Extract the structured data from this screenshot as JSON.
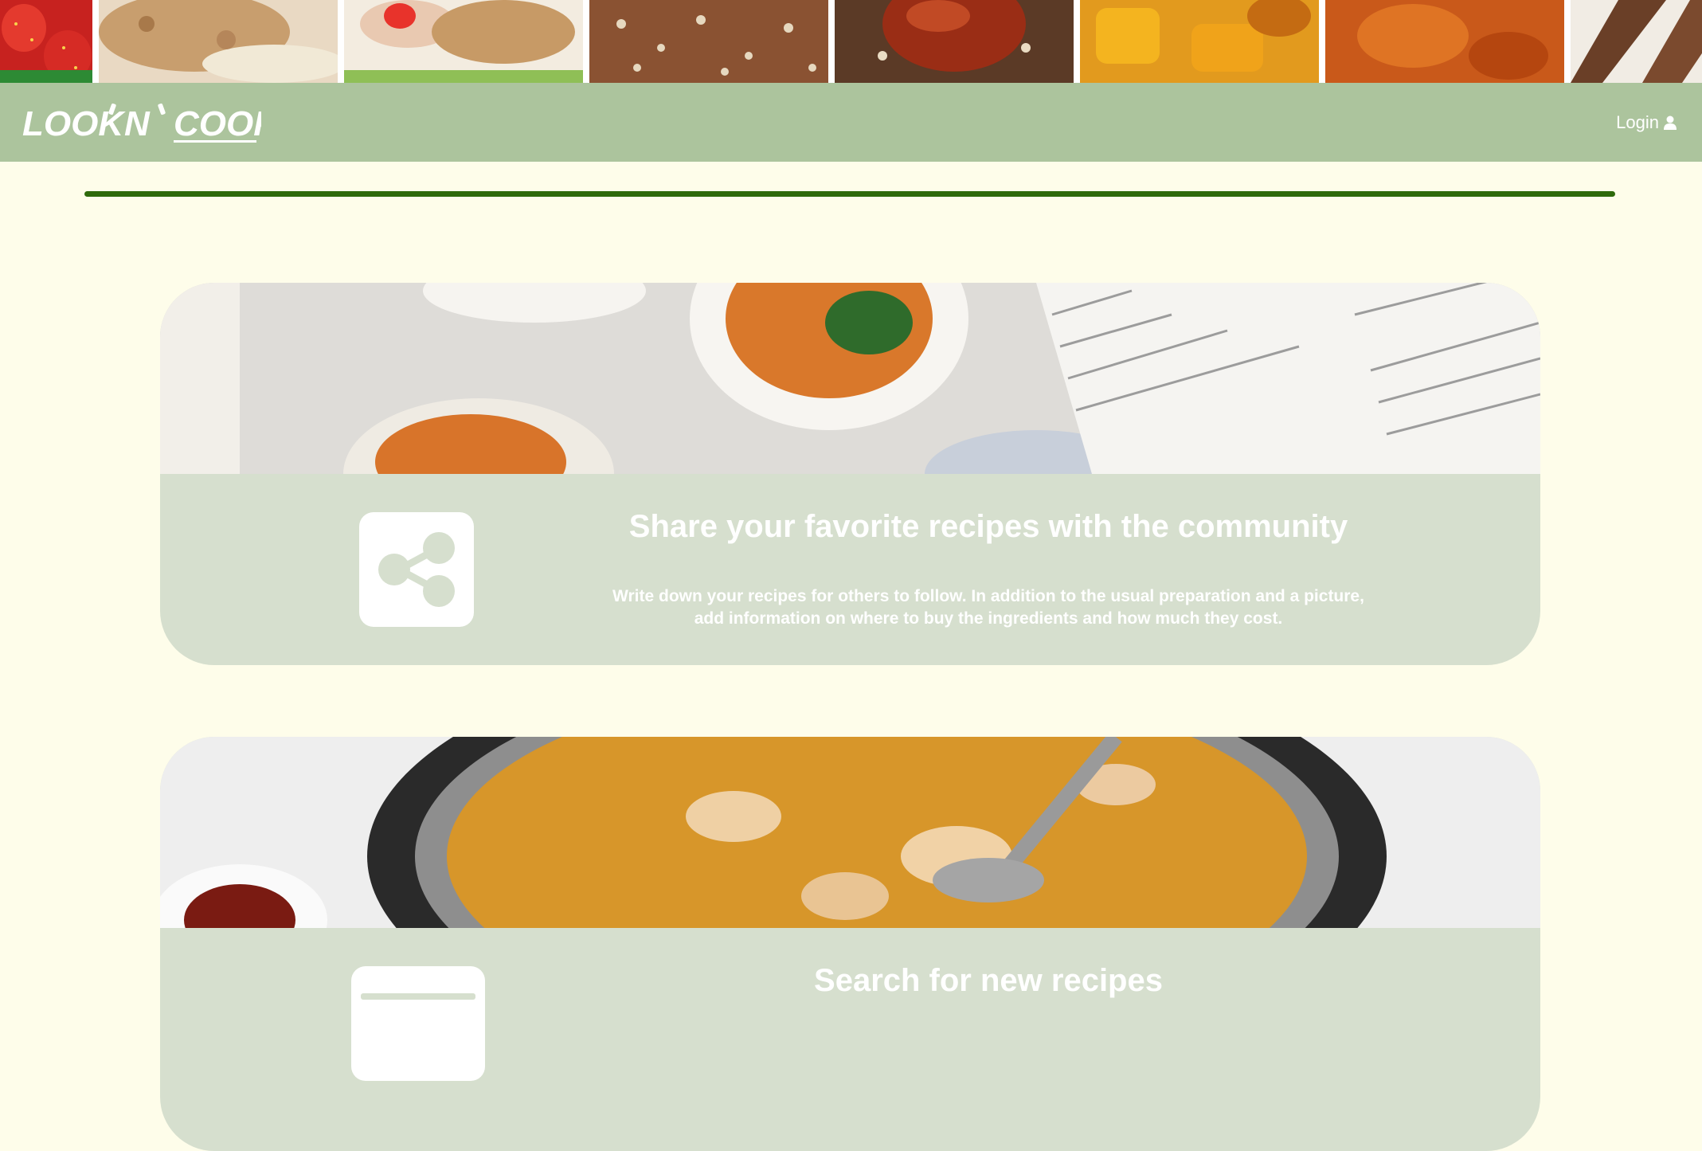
{
  "header": {
    "logo": {
      "look": "LOOK",
      "n": "N",
      "cook": "COOK"
    },
    "login_label": "Login",
    "login_icon": "user-icon"
  },
  "cards": [
    {
      "icon": "share-icon",
      "title": "Share your favorite recipes with the community",
      "description": "Write down your recipes for others to follow. In addition to the usual preparation and a picture, add information on where to buy the ingredients and how much they cost."
    },
    {
      "icon": "search-icon",
      "title": "Search for new recipes"
    }
  ],
  "colors": {
    "page_background": "#fefdea",
    "navbar": "#acc49d",
    "card_body": "#d6dfce",
    "divider": "#2e6a0b",
    "text_on_green": "#ffffff"
  }
}
